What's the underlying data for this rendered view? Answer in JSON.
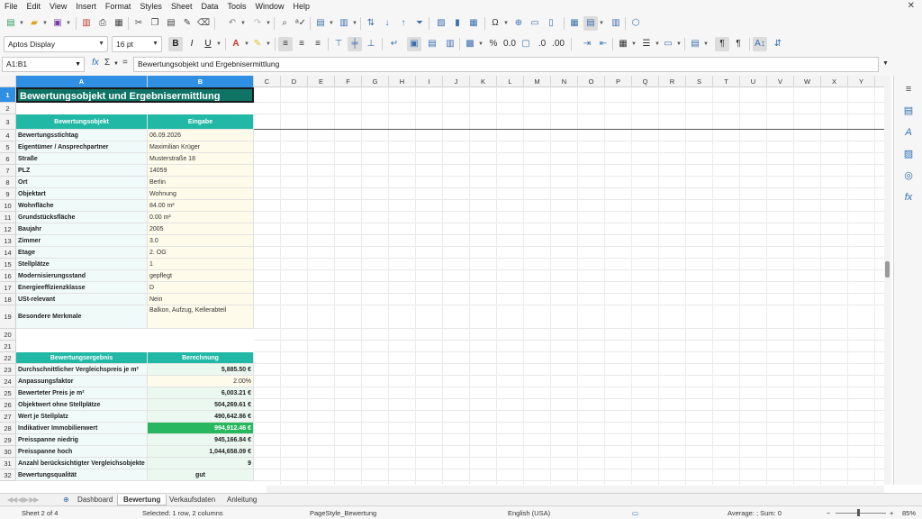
{
  "menu": [
    "File",
    "Edit",
    "View",
    "Insert",
    "Format",
    "Styles",
    "Sheet",
    "Data",
    "Tools",
    "Window",
    "Help"
  ],
  "menu_close": "✕",
  "font_name": "Aptos Display",
  "font_size": "16 pt",
  "name_box": "A1:B1",
  "formula": "Bewertungsobjekt und Ergebnisermittlung",
  "formula_icons": {
    "fx": "fx",
    "sum": "Σ",
    "eq": "="
  },
  "columns": [
    "A",
    "B",
    "C",
    "D",
    "E",
    "F",
    "G",
    "H",
    "I",
    "J",
    "K",
    "L",
    "M",
    "N",
    "O",
    "P",
    "Q",
    "R",
    "S",
    "T",
    "U",
    "V",
    "W",
    "X",
    "Y"
  ],
  "rows": [
    "1",
    "2",
    "3",
    "4",
    "5",
    "6",
    "7",
    "8",
    "9",
    "10",
    "11",
    "12",
    "13",
    "14",
    "15",
    "16",
    "17",
    "18",
    "19",
    "20",
    "21",
    "22",
    "23",
    "24",
    "25",
    "26",
    "27",
    "28",
    "29",
    "30",
    "31",
    "32"
  ],
  "sheet": {
    "title": "Bewertungsobjekt und Ergebnisermittlung",
    "header1": {
      "a": "Bewertungsobjekt",
      "b": "Eingabe"
    },
    "fields": [
      {
        "label": "Bewertungsstichtag",
        "value": "06.09.2026"
      },
      {
        "label": "Eigentümer / Ansprechpartner",
        "value": "Maximilian Krüger"
      },
      {
        "label": "Straße",
        "value": "Musterstraße 18"
      },
      {
        "label": "PLZ",
        "value": "14059"
      },
      {
        "label": "Ort",
        "value": "Berlin"
      },
      {
        "label": "Objektart",
        "value": "Wohnung"
      },
      {
        "label": "Wohnfläche",
        "value": "84.00 m²"
      },
      {
        "label": "Grundstücksfläche",
        "value": "0.00 m²"
      },
      {
        "label": "Baujahr",
        "value": "2005"
      },
      {
        "label": "Zimmer",
        "value": "3.0"
      },
      {
        "label": "Etage",
        "value": "2. OG"
      },
      {
        "label": "Stellplätze",
        "value": "1"
      },
      {
        "label": "Modernisierungsstand",
        "value": "gepflegt"
      },
      {
        "label": "Energieeffizienzklasse",
        "value": "D"
      },
      {
        "label": "USt-relevant",
        "value": "Nein"
      },
      {
        "label": "Besondere Merkmale",
        "value": "Balkon, Aufzug, Kellerabteil"
      }
    ],
    "header2": {
      "a": "Bewertungsergebnis",
      "b": "Berechnung"
    },
    "results": [
      {
        "label": "Durchschnittlicher Vergleichspreis je m²",
        "value": "5,885.50 €"
      },
      {
        "label": "Anpassungsfaktor",
        "value": "2.00%"
      },
      {
        "label": "Bewerteter Preis je m²",
        "value": "6,003.21 €"
      },
      {
        "label": "Objektwert ohne Stellplätze",
        "value": "504,269.61 €"
      },
      {
        "label": "Wert je Stellplatz",
        "value": "490,642.86 €"
      },
      {
        "label": "Indikativer Immobilienwert",
        "value": "994,912.46 €"
      },
      {
        "label": "Preisspanne niedrig",
        "value": "945,166.84 €"
      },
      {
        "label": "Preisspanne hoch",
        "value": "1,044,658.09 €"
      },
      {
        "label": "Anzahl berücksichtigter Vergleichsobjekte",
        "value": "9"
      },
      {
        "label": "Bewertungsqualität",
        "value": "gut"
      }
    ]
  },
  "tabs": [
    "Dashboard",
    "Bewertung",
    "Verkaufsdaten",
    "Anleitung"
  ],
  "tab_add": "⊕",
  "status": {
    "sheet": "Sheet 2 of 4",
    "selection": "Selected: 1 row, 2 columns",
    "pagestyle": "PageStyle_Bewertung",
    "language": "English (USA)",
    "summary": "Average: ; Sum: 0",
    "zoom": "85%"
  },
  "colors": {
    "teal": "#21b8a6",
    "title_bg": "#0f7466",
    "highlight": "#27b85f",
    "select": "#2f8fe3"
  }
}
